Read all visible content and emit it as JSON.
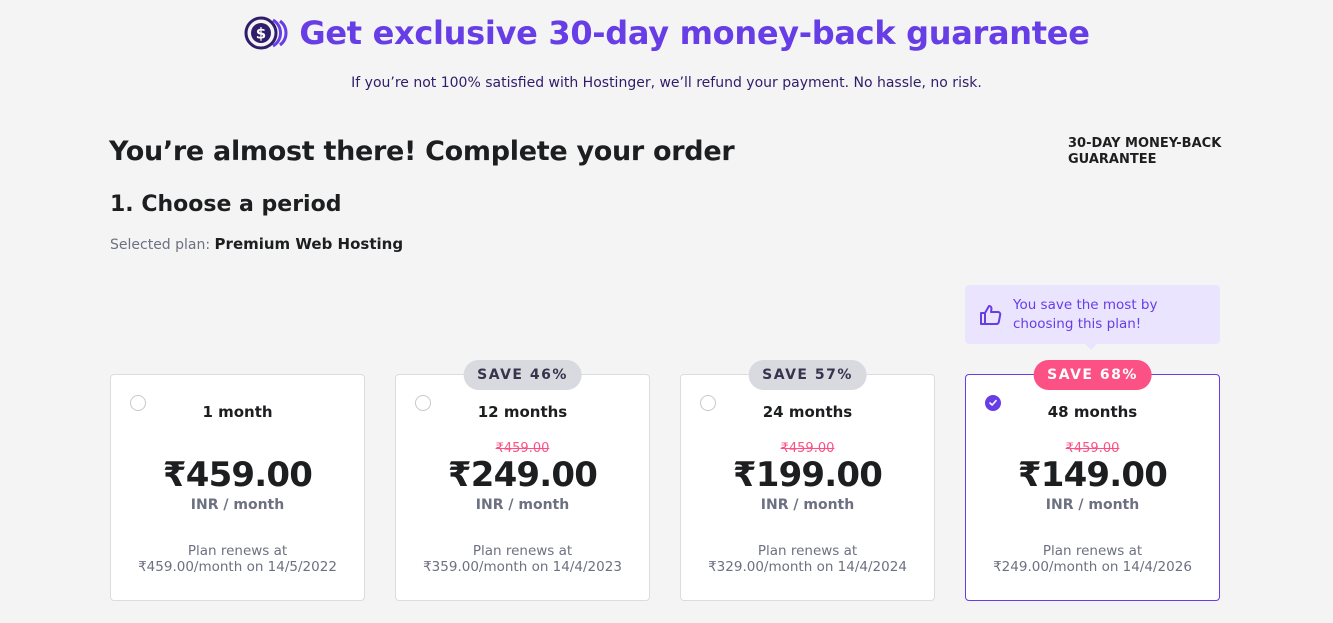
{
  "banner": {
    "title": "Get exclusive 30-day money-back guarantee",
    "subtitle": "If you’re not 100% satisfied with Hostinger, we’ll refund your payment. No hassle, no risk.",
    "icon": "money-back-coin-icon"
  },
  "page": {
    "heading": "You’re almost there! Complete your order",
    "guarantee_label": "30-DAY MONEY-BACK GUARANTEE",
    "step_title": "1. Choose a period",
    "selected_plan_label": "Selected plan:",
    "selected_plan_value": "Premium Web Hosting"
  },
  "tip": {
    "icon": "thumbs-up-icon",
    "text": "You save the most by choosing this plan!"
  },
  "colors": {
    "accent": "#673de6",
    "sale": "#fc5185",
    "text": "#1d1e20",
    "muted": "#6d7081"
  },
  "plans": [
    {
      "period": "1 month",
      "badge": "",
      "old_price": "",
      "price": "₹459.00",
      "unit": "INR / month",
      "renew_line1": "Plan renews at",
      "renew_line2": "₹459.00/month on 14/5/2022",
      "selected": false
    },
    {
      "period": "12 months",
      "badge": "SAVE 46%",
      "old_price": "₹459.00",
      "price": "₹249.00",
      "unit": "INR / month",
      "renew_line1": "Plan renews at",
      "renew_line2": "₹359.00/month on 14/4/2023",
      "selected": false
    },
    {
      "period": "24 months",
      "badge": "SAVE 57%",
      "old_price": "₹459.00",
      "price": "₹199.00",
      "unit": "INR / month",
      "renew_line1": "Plan renews at",
      "renew_line2": "₹329.00/month on 14/4/2024",
      "selected": false
    },
    {
      "period": "48 months",
      "badge": "SAVE 68%",
      "old_price": "₹459.00",
      "price": "₹149.00",
      "unit": "INR / month",
      "renew_line1": "Plan renews at",
      "renew_line2": "₹249.00/month on 14/4/2026",
      "selected": true
    }
  ]
}
